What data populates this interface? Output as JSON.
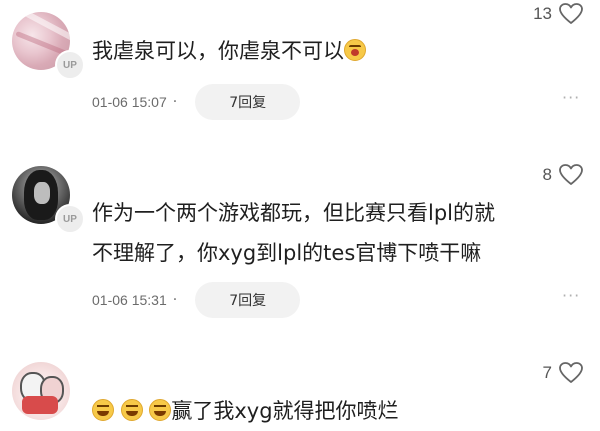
{
  "comments": [
    {
      "text_lines": [
        "我虐泉可以，你虐泉不可以"
      ],
      "trailing_emoji": "shouting-face-emoji",
      "badge": "UP",
      "date": "01-06 15:07",
      "separator": "·",
      "reply_label": "7回复",
      "likes": "13",
      "more": "···"
    },
    {
      "text_lines": [
        "作为一个两个游戏都玩，但比赛只看lpl的就",
        "不理解了，你xyg到lpl的tes官博下喷干嘛"
      ],
      "badge": "UP",
      "date": "01-06 15:31",
      "separator": "·",
      "reply_label": "7回复",
      "likes": "8",
      "more": "···"
    },
    {
      "leading_emojis": [
        "laughing-face-emoji",
        "laughing-face-emoji",
        "laughing-face-emoji"
      ],
      "text_lines": [
        "赢了我xyg就得把你喷烂"
      ],
      "likes": "7"
    }
  ]
}
